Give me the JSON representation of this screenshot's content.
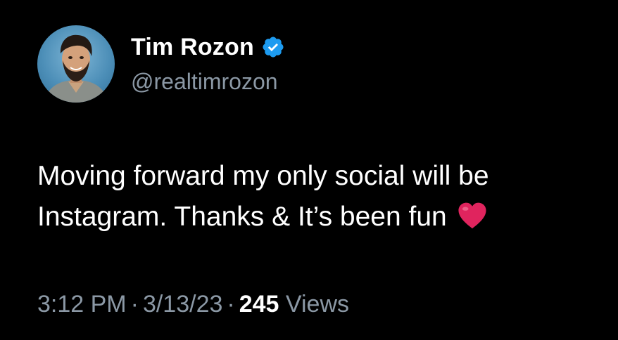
{
  "author": {
    "display_name": "Tim Rozon",
    "handle": "@realtimrozon",
    "verified": true,
    "verified_icon": "verified-badge-icon",
    "verified_color": "#1d9bf0"
  },
  "tweet": {
    "line1": "Moving forward my only social will be",
    "line2": "Instagram. Thanks & It’s been fun",
    "emoji": "heart-icon",
    "emoji_color": "#e0245e"
  },
  "meta": {
    "time": "3:12 PM",
    "separator": "·",
    "date": "3/13/23",
    "views_count": "245",
    "views_label": "Views"
  },
  "colors": {
    "background": "#000000",
    "primary_text": "#ffffff",
    "secondary_text": "#8b98a5"
  }
}
